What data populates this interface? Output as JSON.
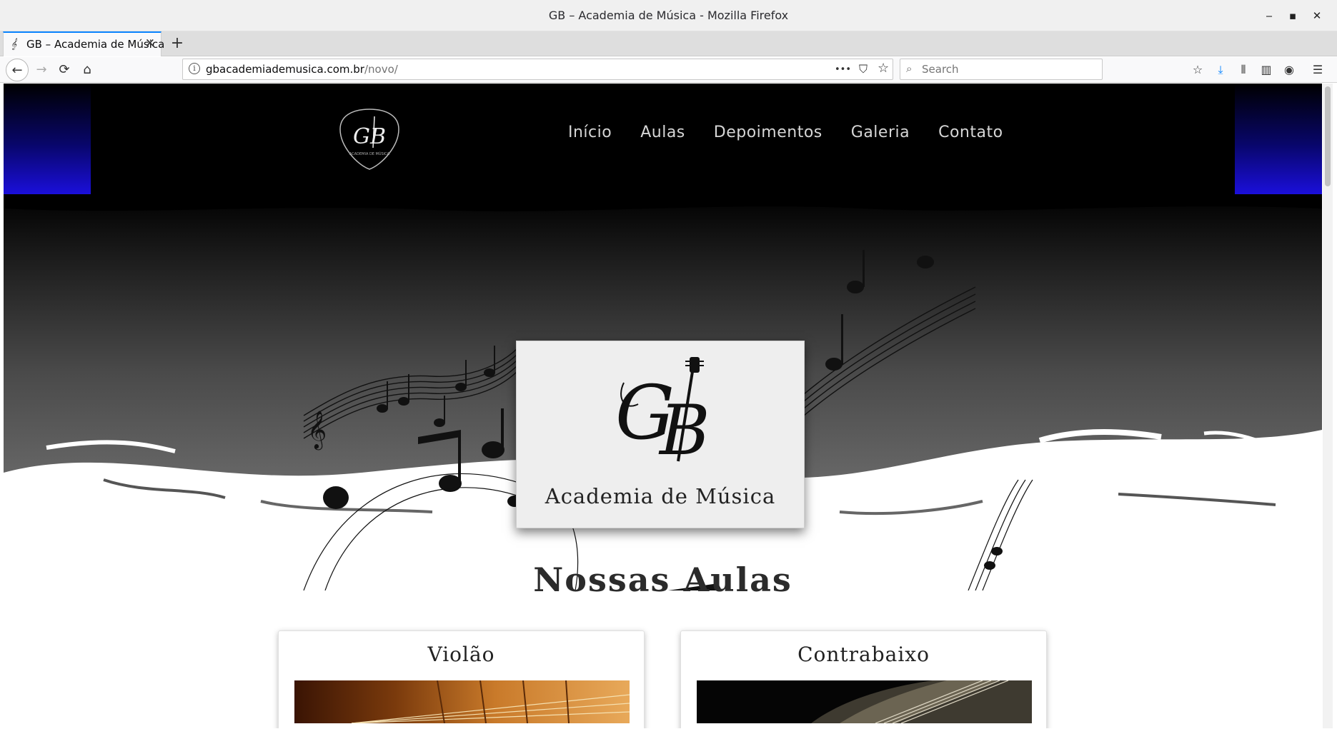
{
  "window": {
    "title": "GB – Academia de Música - Mozilla Firefox",
    "minimize_glyph": "‒",
    "maximize_glyph": "▪",
    "close_glyph": "✕"
  },
  "tabs": [
    {
      "label": "GB – Academia de Música",
      "favicon": "𝄞",
      "close_glyph": "✕"
    }
  ],
  "new_tab_glyph": "+",
  "nav": {
    "back_glyph": "←",
    "forward_glyph": "→",
    "reload_glyph": "⟳",
    "home_glyph": "⌂",
    "url_host": "gbacademiademusica.com.br",
    "url_path": "/novo/",
    "info_glyph": "i",
    "page_actions_glyph": "•••",
    "pocket_glyph": "⛉",
    "bookmark_glyph": "☆",
    "search_placeholder": "Search",
    "search_glyph": "⌕",
    "toolbar_icons": [
      "bookmarks-star-icon",
      "download-icon",
      "library-icon",
      "sidebar-icon",
      "account-icon",
      "menu-icon"
    ],
    "toolbar_glyphs": [
      "☆",
      "⤓",
      "⫴",
      "▥",
      "◉",
      "☰"
    ]
  },
  "site": {
    "menu": [
      "Início",
      "Aulas",
      "Depoimentos",
      "Galeria",
      "Contato"
    ],
    "hero_card_text": "Academia de Música",
    "section_title": "Nossas Aulas",
    "courses": [
      {
        "title": "Violão"
      },
      {
        "title": "Contrabaixo"
      }
    ],
    "colors": {
      "header_bg": "#000000",
      "accent_blue": "#1b0fdb",
      "card_bg": "#eeeeee",
      "menu_text": "#d6d6d6"
    }
  }
}
